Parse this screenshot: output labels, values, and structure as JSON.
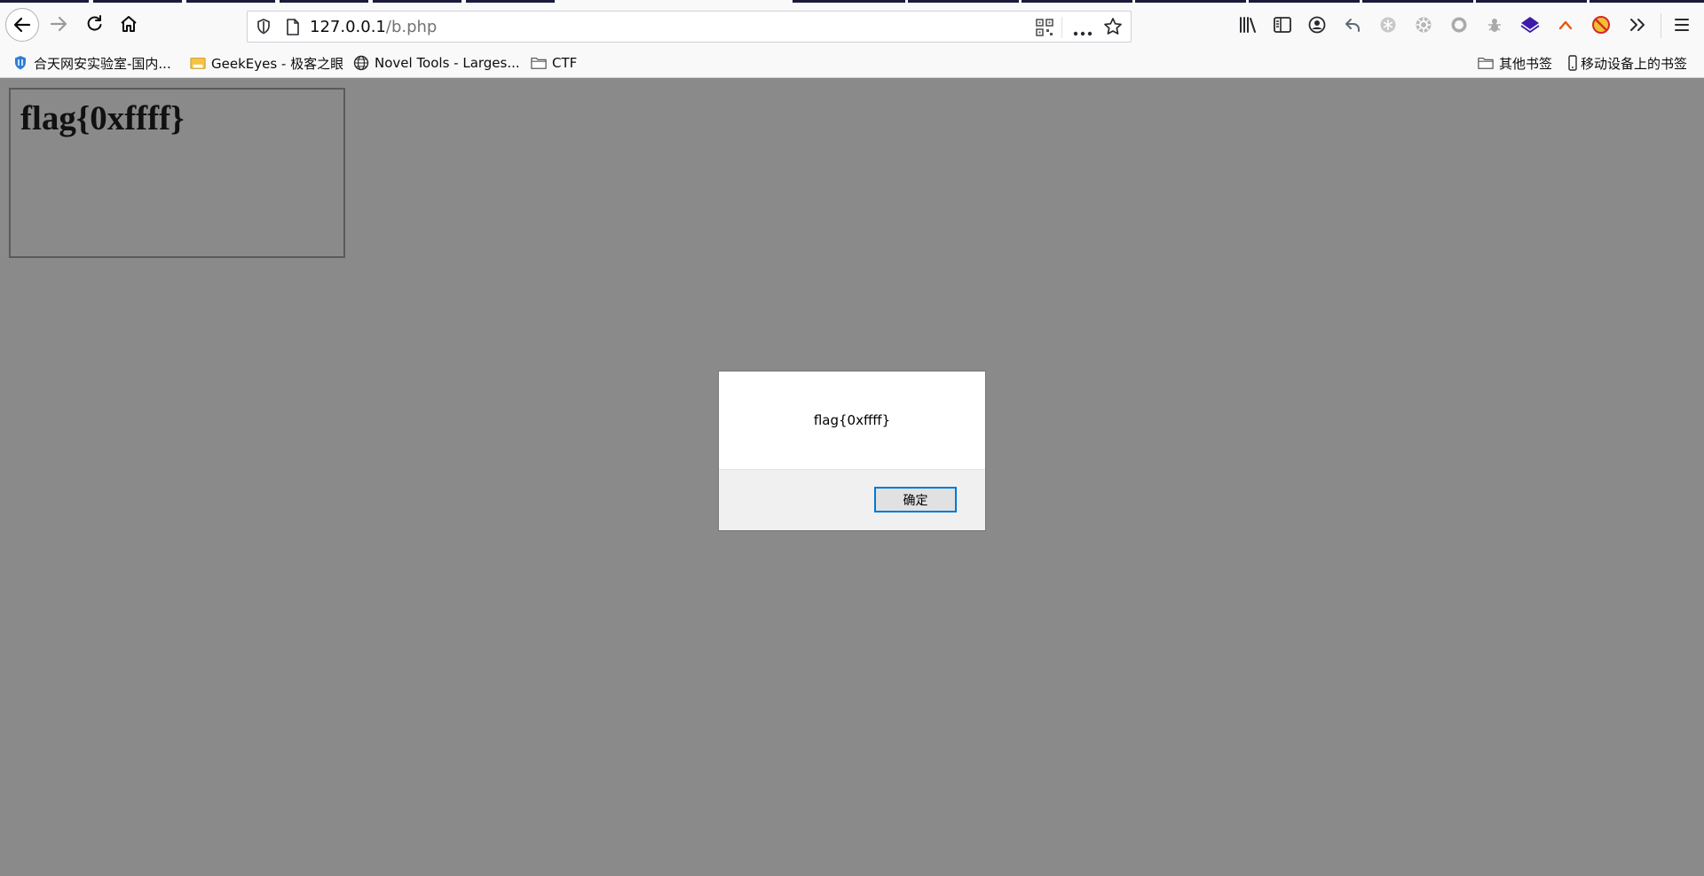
{
  "browser": {
    "url_host": "127.0.0.1",
    "url_path": "/b.php"
  },
  "bookmarks": {
    "left": [
      {
        "label": "合天网安实验室-国内...",
        "icon": "shield-icon"
      },
      {
        "label": "GeekEyes - 极客之眼",
        "icon": "folder-colored-icon"
      },
      {
        "label": "Novel Tools - Larges...",
        "icon": "globe-icon"
      },
      {
        "label": "CTF",
        "icon": "folder-icon"
      }
    ],
    "right": [
      {
        "label": "其他书签",
        "icon": "folder-icon"
      },
      {
        "label": "移动设备上的书签",
        "icon": "mobile-icon"
      }
    ]
  },
  "page": {
    "heading": "flag{0xffff}"
  },
  "alert": {
    "message": "flag{0xffff}",
    "ok_label": "确定"
  },
  "colors": {
    "page_overlay": "#8a8a8a",
    "dialog_focus": "#0078d7",
    "tab_accent": "#1a1a3a"
  }
}
